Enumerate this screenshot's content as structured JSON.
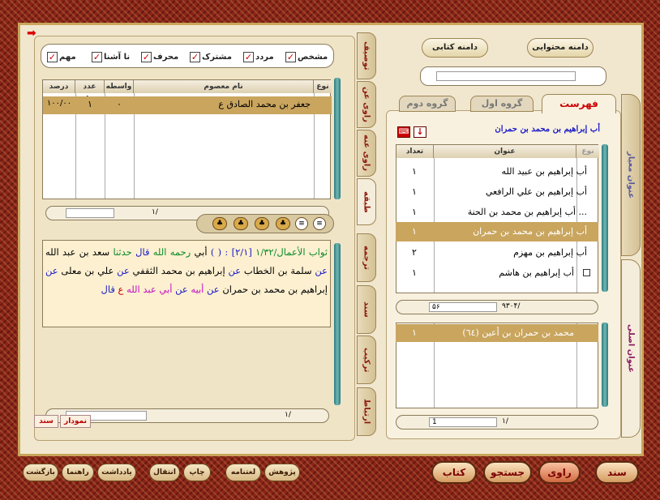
{
  "left": {
    "checkboxes": [
      {
        "label": "مشخص",
        "checked": true
      },
      {
        "label": "مردد",
        "checked": true
      },
      {
        "label": "مشترک",
        "checked": true
      },
      {
        "label": "محرف",
        "checked": true
      },
      {
        "label": "نا آشنا",
        "checked": true
      },
      {
        "label": "مهم",
        "checked": true
      }
    ],
    "table_headers": {
      "type": "نوع",
      "name": "نام معصوم",
      "wasita": "واسطه",
      "count": "عدد نقل",
      "percent": "درصد"
    },
    "row": {
      "name": "جعفر بن محمد الصادق ع",
      "wasita": "۰",
      "count": "۱",
      "percent": "۱۰۰/۰۰"
    },
    "page_counter": "۱/",
    "hadith": {
      "source": "ثواب الأعمال/۱/۳۲",
      "ref": "[۲/۱] :",
      "parens": "( )",
      "t1": "أبي",
      "t2": "رحمه الله",
      "t3": "قال",
      "t4": "حدثنا",
      "t5": "سعد بن عبد الله",
      "t6": "عن",
      "t7": "سلمة بن الخطاب",
      "t8": "عن",
      "t9": "إبراهيم بن محمد الثقفي",
      "t10": "عن",
      "t11": "علي بن معلى",
      "t12": "عن",
      "t13": "إبراهيم بن محمد بن حمران",
      "t14": "عن",
      "t15": "أبيه",
      "t16": "عن",
      "t17": "أبي عبد الله",
      "t18": "ع",
      "t19": "قال"
    },
    "bottom_counter": "۱/",
    "tags": {
      "sanad": "سند",
      "nemoodar": "نمودار"
    }
  },
  "left_tabs": [
    "توصیف",
    "راوی عن",
    "راوی عنه",
    "طبقه",
    "ترجمه",
    "سند",
    "ترکیب",
    "ارتباط"
  ],
  "right": {
    "top_buttons": {
      "content": "دامنه محتوایی",
      "book": "دامنه کتابی"
    },
    "tabs": {
      "index": "فهرست",
      "group1": "گروه اول",
      "group2": "گروه دوم"
    },
    "selected_title": "أب إبراهيم بن محمد بن حمران",
    "list_headers": {
      "type": "نوع",
      "title": "عنوان",
      "count": "تعداد"
    },
    "rows": [
      {
        "title": "أب إبراهيم بن عبيد الله",
        "count": "۱"
      },
      {
        "title": "أب إبراهيم بن علي الرافعي",
        "count": "۱"
      },
      {
        "title": "أب إبراهيم بن محمد بن الحنة ...",
        "count": "۱"
      },
      {
        "title": "أب إبراهيم بن محمد بن حمران",
        "count": "۱"
      },
      {
        "title": "أب إبراهيم بن مهزم",
        "count": "۲"
      },
      {
        "title": "أب إبراهيم بن هاشم",
        "count": "۱"
      }
    ],
    "counter_total": "۹۳۰۴/",
    "counter_page": "۵۶",
    "bottom_row": {
      "title": "محمد بن حمران بن أعين (٦٤)",
      "count": "۱"
    },
    "bottom_counter": "۱/",
    "bottom_page": "1",
    "side_tabs": {
      "standard": "عنوان معیار",
      "original": "عنوان اصلی"
    }
  },
  "bottom_bar": {
    "left_buttons": [
      "بازگشت",
      "راهنما",
      "یادداشت",
      "انتقال",
      "چاپ",
      "لغتنامه",
      "پژوهش"
    ],
    "big_buttons": [
      "کتاب",
      "جستجو",
      "راوی",
      "سند"
    ]
  }
}
